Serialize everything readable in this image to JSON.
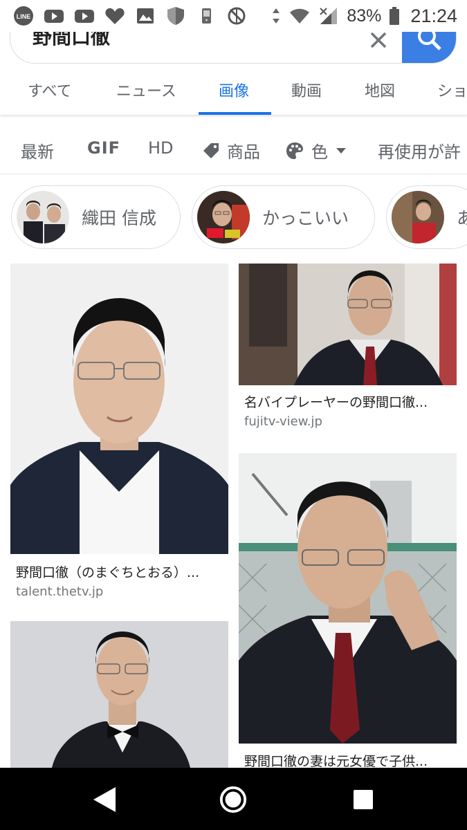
{
  "status_bar": {
    "battery": "83%",
    "time": "21:24",
    "icons": [
      "line-icon",
      "youtube-icon",
      "youtube-icon",
      "heart-icon",
      "image-icon",
      "shield-icon",
      "robot-icon",
      "no-sync-icon",
      "data-arrows-icon",
      "wifi-icon",
      "signal-icon",
      "battery-icon"
    ]
  },
  "search": {
    "query": "野間口徹",
    "clear_icon": "close-icon",
    "search_icon": "search-icon"
  },
  "tabs": [
    {
      "label": "すべて"
    },
    {
      "label": "ニュース"
    },
    {
      "label": "画像",
      "active": true
    },
    {
      "label": "動画"
    },
    {
      "label": "地図"
    },
    {
      "label": "ショ"
    }
  ],
  "filters": {
    "latest": "最新",
    "gif": "GIF",
    "hd": "HD",
    "products": "商品",
    "color": "色",
    "reuse": "再使用が許"
  },
  "chips": [
    {
      "label": "織田 信成"
    },
    {
      "label": "かっこいい"
    },
    {
      "label": "あ"
    }
  ],
  "results": [
    {
      "title": "野間口徹（のまぐちとおる）...",
      "source": "talent.thetv.jp"
    },
    {
      "title": "名バイプレーヤーの野間口徹...",
      "source": "fujitv-view.jp"
    },
    {
      "title": "野間口徹の妻は元女優で子供...",
      "source": ""
    },
    {
      "title": "",
      "source": ""
    }
  ],
  "colors": {
    "accent": "#1a73e8",
    "search_button": "#3b7fe4"
  }
}
